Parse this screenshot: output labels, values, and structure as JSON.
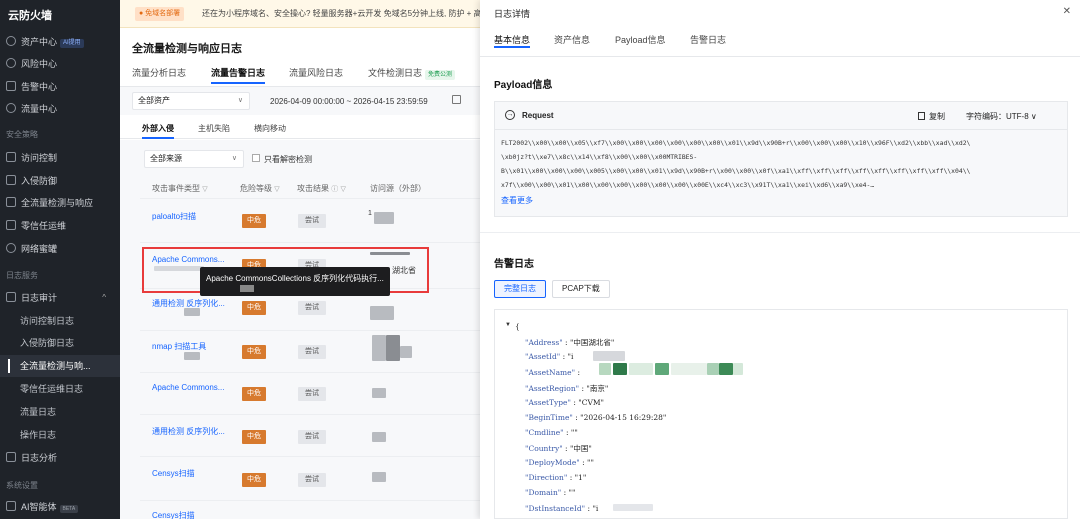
{
  "sidebar": {
    "brand": "云防火墙",
    "items": [
      {
        "label": "资产中心",
        "badge": "AI提用"
      },
      {
        "label": "风险中心"
      },
      {
        "label": "告警中心"
      },
      {
        "label": "流量中心"
      }
    ],
    "section_security": "安全策略",
    "policy_items": [
      {
        "label": "访问控制"
      },
      {
        "label": "入侵防御"
      },
      {
        "label": "全流量检测与响应"
      },
      {
        "label": "零信任运维"
      },
      {
        "label": "网络蜜罐"
      }
    ],
    "section_logs": "日志服务",
    "log_audit": "日志审计",
    "log_subitems": [
      "访问控制日志",
      "入侵防御日志",
      "全流量检测与响...",
      "零信任运维日志",
      "流量日志",
      "操作日志"
    ],
    "log_analysis": "日志分析",
    "section_system": "系统设置",
    "ai_item": "AI智能体",
    "ai_badge": "BETA"
  },
  "main": {
    "banner_tag": "● 免域名部署",
    "banner_text": "还在为小程序域名、安全操心? 轻量服务器+云开发 免域名5分钟上线, 防护 + 高性能",
    "page_title": "全流量检测与响应日志",
    "tabs": [
      "流量分析日志",
      "流量告警日志",
      "流量风险日志",
      "文件检测日志"
    ],
    "tab_badge": "免费公测",
    "asset_select": "全部资产",
    "date_range": "2026-04-09 00:00:00  ~ 2026-04-15 23:59:59",
    "subtabs": [
      "外部入侵",
      "主机失陷",
      "横向移动"
    ],
    "source_select": "全部来源",
    "decrypt_label": "只看解密检测",
    "columns": [
      "攻击事件类型",
      "危险等级",
      "攻击结果",
      "访问源（外部）"
    ],
    "rows": [
      {
        "name": "paloalto扫描",
        "risk": "中危",
        "result": "尝试"
      },
      {
        "name": "Apache Commons...",
        "risk": "中危",
        "result": "尝试"
      },
      {
        "name": "通用检测 反序列化...",
        "risk": "中危",
        "result": "尝试"
      },
      {
        "name": "nmap 扫描工具",
        "risk": "中危",
        "result": "尝试"
      },
      {
        "name": "Apache Commons...",
        "risk": "中危",
        "result": "尝试"
      },
      {
        "name": "通用检测 反序列化...",
        "risk": "中危",
        "result": "尝试"
      },
      {
        "name": "Censys扫描",
        "risk": "中危",
        "result": "尝试"
      },
      {
        "name": "Censys扫描",
        "risk": "中危",
        "result": "尝试"
      }
    ],
    "row2_location": "湖北省",
    "row1_text": "1",
    "tooltip": "Apache CommonsCollections 反序列化代码执行..."
  },
  "drawer": {
    "title": "日志详情",
    "tabs": [
      "基本信息",
      "资产信息",
      "Payload信息",
      "告警日志"
    ],
    "payload_title": "Payload信息",
    "request_label": "Request",
    "copy_label": "复制",
    "encoding_label": "字符编码：UTF-8",
    "payload_lines": [
      "FLT2002\\\\x00\\\\x00\\\\x05\\\\xf7\\\\x00\\\\x00\\\\x00\\\\x00\\\\x00\\\\x00\\\\x01\\\\x9d\\\\x90B+r\\\\x00\\\\x00\\\\x00\\\\x10\\\\x96F\\\\xd2\\\\xbb\\\\xad\\\\xd2\\",
      "\\xb0jz?t\\\\xe7\\\\x8c\\\\x14\\\\xf8\\\\x00\\\\x00\\\\x00MTRIBES-",
      "B\\\\x01\\\\x00\\\\x00\\\\x00\\\\x005\\\\x00\\\\x00\\\\x01\\\\x9d\\\\x90B+r\\\\x00\\\\x00\\\\x0f\\\\xa1\\\\xff\\\\xff\\\\xff\\\\xff\\\\xff\\\\xff\\\\xff\\\\xff\\\\x04\\\\",
      "x7f\\\\x00\\\\x00\\\\x01\\\\x00\\\\x00\\\\x00\\\\x00\\\\x00\\\\x00\\\\x00E\\\\xc4\\\\xc3\\\\x91T\\\\xa1\\\\xei\\\\xd6\\\\xa9\\\\xe4-…"
    ],
    "see_more": "查看更多",
    "alert_title": "告警日志",
    "btn_full": "完整日志",
    "btn_pcap": "PCAP下载",
    "json_open": "{",
    "json_fields": [
      {
        "key": "\"Address\"",
        "value": ": \"中国湖北省\""
      },
      {
        "key": "\"AssetId\"",
        "value": ": \"i"
      },
      {
        "key": "\"AssetName\"",
        "value": ":"
      },
      {
        "key": "\"AssetRegion\"",
        "value": ": \"南京\""
      },
      {
        "key": "\"AssetType\"",
        "value": ": \"CVM\""
      },
      {
        "key": "\"BeginTime\"",
        "value": ": \"2026-04-15 16:29:28\""
      },
      {
        "key": "\"Cmdline\"",
        "value": ": \"\""
      },
      {
        "key": "\"Country\"",
        "value": ": \"中国\""
      },
      {
        "key": "\"DeployMode\"",
        "value": ": \"\""
      },
      {
        "key": "\"Direction\"",
        "value": ": \"1\""
      },
      {
        "key": "\"Domain\"",
        "value": ": \"\""
      },
      {
        "key": "\"DstInstanceId\"",
        "value": ": \"i"
      }
    ]
  }
}
